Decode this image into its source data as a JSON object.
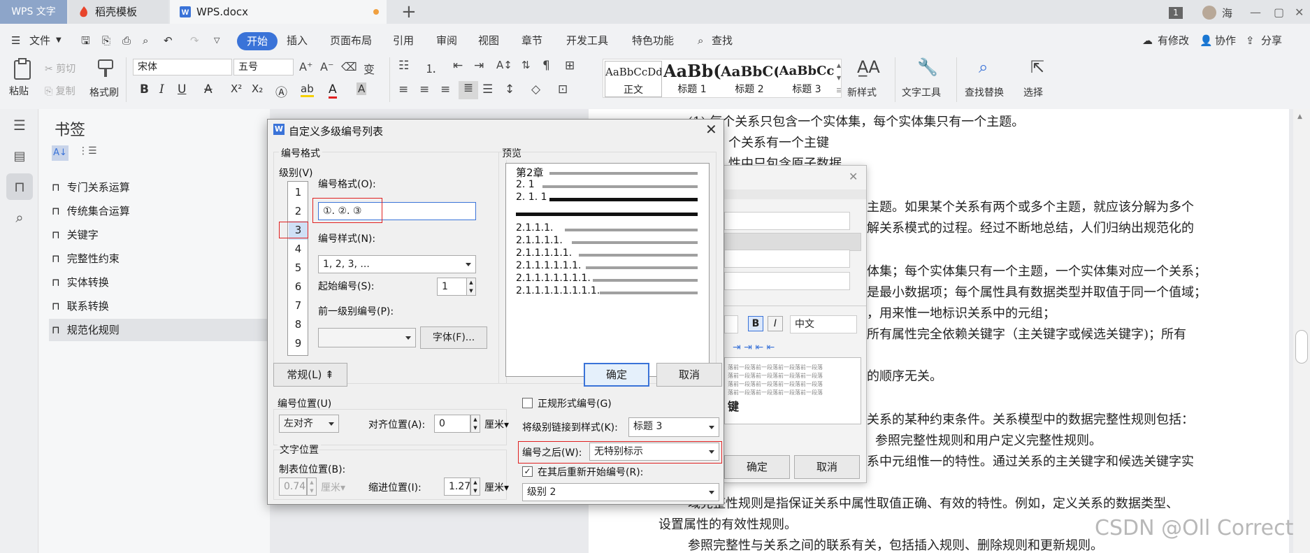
{
  "tabs": {
    "app": "WPS 文字",
    "template": "稻壳模板",
    "doc": "WPS.docx",
    "window_count": "1",
    "user": "海"
  },
  "menu": {
    "file": "文件",
    "items": [
      "开始",
      "插入",
      "页面布局",
      "引用",
      "审阅",
      "视图",
      "章节",
      "开发工具",
      "特色功能"
    ],
    "search": "查找",
    "right": [
      "有修改",
      "协作",
      "分享"
    ]
  },
  "ribbon": {
    "paste": "粘贴",
    "cut": "剪切",
    "copy": "复制",
    "format_painter": "格式刷",
    "font_name": "宋体",
    "font_size": "五号",
    "styles": [
      {
        "preview": "AaBbCcDd",
        "label": "正文"
      },
      {
        "preview": "AaBb(",
        "label": "标题 1"
      },
      {
        "preview": "AaBbC(",
        "label": "标题 2"
      },
      {
        "preview": "AaBbCc",
        "label": "标题 3"
      }
    ],
    "new_style": "新样式",
    "text_tools": "文字工具",
    "find_replace": "查找替换",
    "select": "选择"
  },
  "bookmarks": {
    "title": "书签",
    "items": [
      "专门关系运算",
      "传统集合运算",
      "关键字",
      "完整性约束",
      "实体转换",
      "联系转换",
      "规范化规则"
    ]
  },
  "document": {
    "lines": [
      "(1) 每个关系只包含一个实体集，每个实体集只有一个主题。",
      "个关系有一个主键",
      "性中只包含原子数据",
      "主题。如果某个关系有两个或多个主题，就应该分解为多个",
      "解关系模式的过程。经过不断地总结，人们归纳出规范化的",
      "体集；每个实体集只有一个主题，一个实体集对应一个关系；",
      "是最小数据项；每个属性具有数据类型并取值于同一个值域；",
      "，用来惟一地标识关系中的元组；",
      "所有属性完全依赖关键字（主关键字或候选关键字)；所有",
      "的顺序无关。",
      "关系的某种约束条件。关系模型中的数据完整性规则包括：",
      "参照完整性规则和用户定义完整性规则。",
      "系中元组惟一的特性。通过关系的主关键字和候选关键字实",
      "域完整性规则是指保证关系中属性取值正确、有效的特性。例如，定义关系的数据类型、",
      "设置属性的有效性规则。",
      "参照完整性与关系之间的联系有关，包括插入规则、删除规则和更新规则。"
    ]
  },
  "bg_dialog": {
    "lang": "中文",
    "preview_line": "落前一段落前一段落前一段落前一段落",
    "bold_text": "键",
    "ok": "确定",
    "cancel": "取消"
  },
  "dialog": {
    "title": "自定义多级编号列表",
    "number_format_group": "编号格式",
    "level_label": "级别(V)",
    "levels": [
      "1",
      "2",
      "3",
      "4",
      "5",
      "6",
      "7",
      "8",
      "9"
    ],
    "selected_level": "3",
    "format_label": "编号格式(O):",
    "format_value": "①. ②. ③",
    "style_label": "编号样式(N):",
    "style_value": "1, 2, 3, ...",
    "start_label": "起始编号(S):",
    "start_value": "1",
    "prev_level_label": "前一级别编号(P):",
    "font_button": "字体(F)...",
    "preview_label": "预览",
    "preview_lines": [
      "第2章",
      "2. 1",
      "2. 1. 1",
      "2.1.1.1.",
      "2.1.1.1.1.",
      "2.1.1.1.1.1.",
      "2.1.1.1.1.1.1.",
      "2.1.1.1.1.1.1.1.",
      "2.1.1.1.1.1.1.1.1."
    ],
    "normal_button": "常规(L) ⇞",
    "ok": "确定",
    "cancel": "取消",
    "position_group": "编号位置(U)",
    "align_value": "左对齐",
    "align_pos_label": "对齐位置(A):",
    "align_pos_value": "0",
    "unit": "厘米",
    "text_pos_group": "文字位置",
    "tab_label": "制表位位置(B):",
    "tab_value": "0.74",
    "indent_label": "缩进位置(I):",
    "indent_value": "1.27",
    "legal_label": "正规形式编号(G)",
    "link_label": "将级别链接到样式(K):",
    "link_value": "标题 3",
    "after_label": "编号之后(W):",
    "after_value": "无特别标示",
    "restart_label": "在其后重新开始编号(R):",
    "restart_value": "级别 2"
  },
  "watermark": "CSDN @Oll Correct",
  "colors": {
    "accent": "#3a73d8",
    "highlight": "#e02020"
  }
}
